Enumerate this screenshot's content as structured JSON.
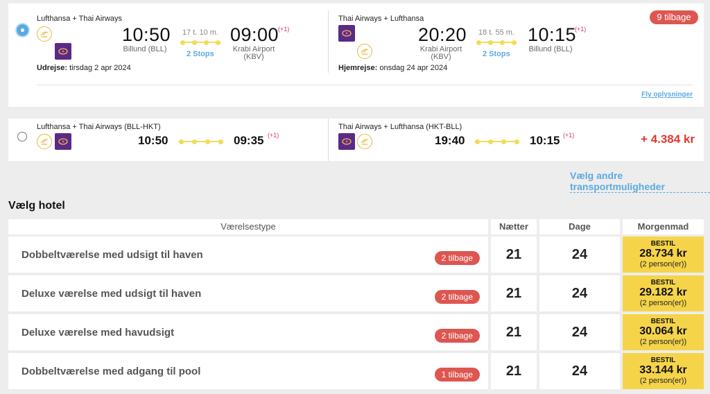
{
  "selected_offer": {
    "outbound": {
      "airlines": "Lufthansa + Thai Airways",
      "depart_time": "10:50",
      "depart_airport": "Billund (BLL)",
      "duration": "17 t. 10 m.",
      "stops": "2 Stops",
      "arrive_time": "09:00",
      "arrive_plus": "(+1)",
      "arrive_airport_line1": "Krabi Airport",
      "arrive_airport_line2": "(KBV)",
      "date_label": "Udrejse:",
      "date_value": "tirsdag 2 apr 2024"
    },
    "return": {
      "airlines": "Thai Airways + Lufthansa",
      "depart_time": "20:20",
      "depart_airport_line1": "Krabi Airport",
      "depart_airport_line2": "(KBV)",
      "duration": "18 t. 55 m.",
      "stops": "2 Stops",
      "arrive_time": "10:15",
      "arrive_plus": "(+1)",
      "arrive_airport": "Billund (BLL)",
      "date_label": "Hjemrejse:",
      "date_value": "onsdag 24 apr 2024"
    },
    "availability_badge": "9 tilbage",
    "flight_info_link": "Fly oplysninger"
  },
  "alternative_offer": {
    "outbound": {
      "airlines": "Lufthansa + Thai Airways (BLL-HKT)",
      "depart_time": "10:50",
      "arrive_time": "09:35",
      "arrive_plus": "(+1)"
    },
    "return": {
      "airlines": "Thai Airways + Lufthansa (HKT-BLL)",
      "depart_time": "19:40",
      "arrive_time": "10:15",
      "arrive_plus": "(+1)"
    },
    "price_diff": "+ 4.384 kr"
  },
  "other_transport_link": "Vælg andre transportmuligheder",
  "hotel": {
    "title": "Vælg hotel",
    "headers": {
      "room_type": "Værelsestype",
      "nights": "Nætter",
      "days": "Dage",
      "board": "Morgenmad"
    },
    "rows": [
      {
        "room": "Dobbeltværelse med udsigt til haven",
        "badge": "2 tilbage",
        "nights": "21",
        "days": "24",
        "cta": "BESTIL",
        "price": "28.734 kr",
        "persons": "(2 person(er))"
      },
      {
        "room": "Deluxe værelse med udsigt til haven",
        "badge": "2 tilbage",
        "nights": "21",
        "days": "24",
        "cta": "BESTIL",
        "price": "29.182 kr",
        "persons": "(2 person(er))"
      },
      {
        "room": "Deluxe værelse med havudsigt",
        "badge": "2 tilbage",
        "nights": "21",
        "days": "24",
        "cta": "BESTIL",
        "price": "30.064 kr",
        "persons": "(2 person(er))"
      },
      {
        "room": "Dobbeltværelse med adgang til pool",
        "badge": "1 tilbage",
        "nights": "21",
        "days": "24",
        "cta": "BESTIL",
        "price": "33.144 kr",
        "persons": "(2 person(er))"
      }
    ]
  },
  "colors": {
    "accent_blue": "#5aa9e0",
    "badge_red": "#dd5650",
    "price_red": "#e0392d",
    "route_yellow": "#f2dc58",
    "cta_yellow": "#f5d44a",
    "thai_purple": "#5b2a86",
    "lufthansa_gold": "#e9b838"
  },
  "icons": {
    "lufthansa": "lufthansa-crane-logo",
    "thai": "thai-airways-orchid-logo"
  }
}
